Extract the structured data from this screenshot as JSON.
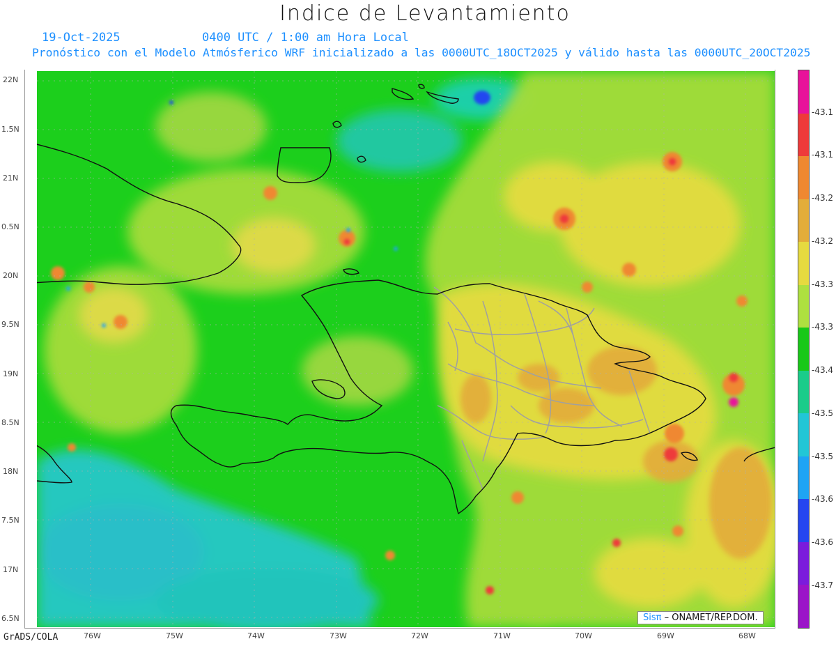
{
  "header": {
    "title": "Indice de Levantamiento",
    "date": "19-Oct-2025",
    "time": "0400 UTC / 1:00 am Hora Local",
    "forecast": "Pronóstico con el Modelo Atmósferico WRF inicializado a las 0000UTC_18OCT2025 y válido hasta las  0000UTC_20OCT2025"
  },
  "map": {
    "lat_labels": [
      "22N",
      "1.5N",
      "21N",
      "0.5N",
      "20N",
      "9.5N",
      "19N",
      "8.5N",
      "18N",
      "7.5N",
      "17N",
      "6.5N"
    ],
    "lon_labels": [
      "76W",
      "75W",
      "74W",
      "73W",
      "72W",
      "71W",
      "70W",
      "69W",
      "68W"
    ],
    "coastline_color": "#111111",
    "provinces_color": "#a0a0a0"
  },
  "colorbar": {
    "labels": [
      "-43.1",
      "-43.1",
      "-43.2",
      "-43.2",
      "-43.3",
      "-43.3",
      "-43.4",
      "-43.5",
      "-43.5",
      "-43.6",
      "-43.6",
      "-43.7"
    ],
    "colors": [
      "#e8129a",
      "#ee3a3a",
      "#ef8830",
      "#e3ad3a",
      "#e6da40",
      "#aee040",
      "#18c818",
      "#1acc8a",
      "#22c6d6",
      "#1ea4f4",
      "#2446f0",
      "#7b1cdc",
      "#9b14c8"
    ]
  },
  "footer": {
    "software": "GrADS/COLA",
    "credit_brand": "Sisπ",
    "credit_text": " – ONAMET/REP.DOM."
  }
}
